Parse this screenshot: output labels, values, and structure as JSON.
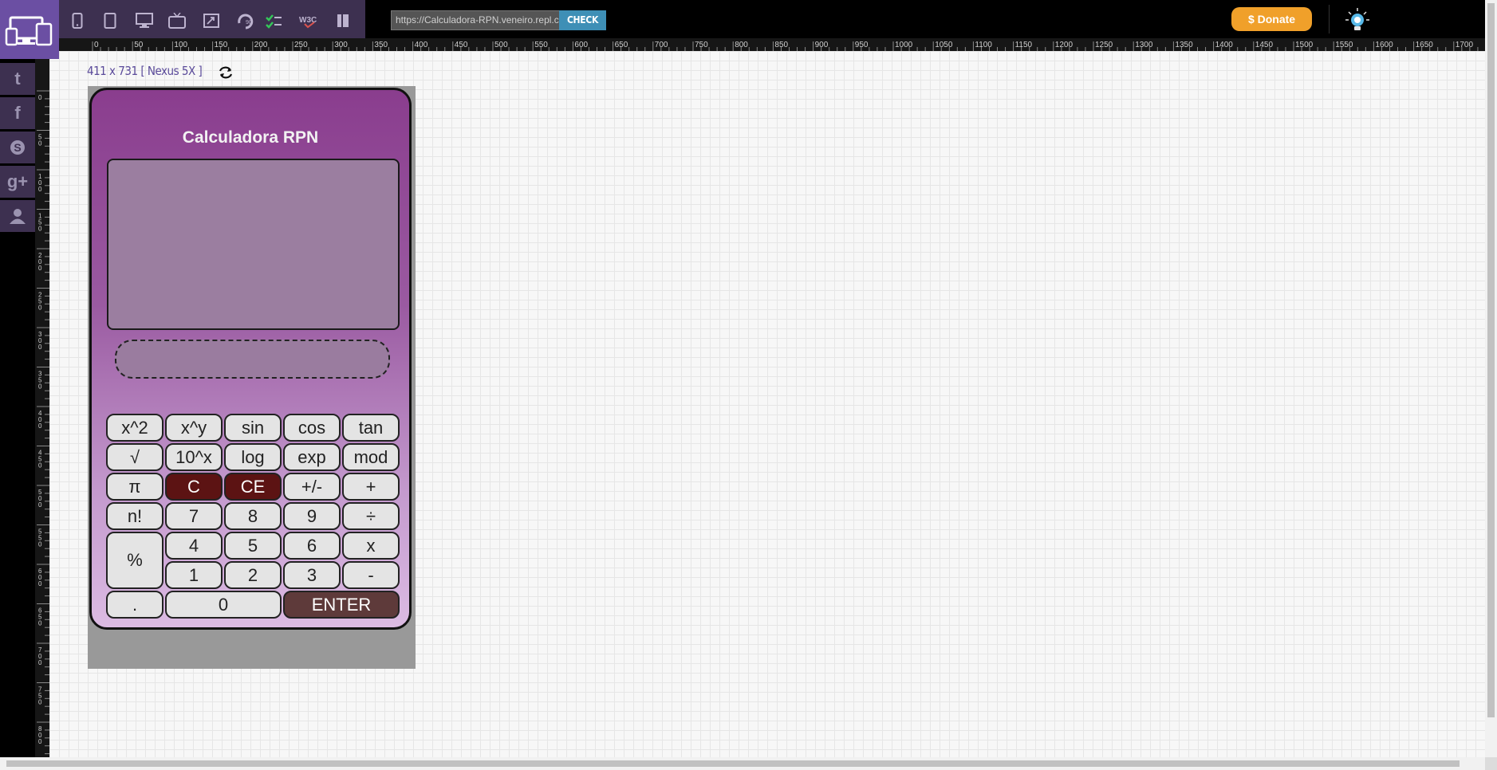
{
  "toolbar": {
    "tools": [
      {
        "name": "mobile-device-icon"
      },
      {
        "name": "tablet-device-icon"
      },
      {
        "name": "desktop-device-icon"
      },
      {
        "name": "tv-device-icon"
      },
      {
        "name": "screen-resize-icon"
      },
      {
        "name": "rotate-90-icon"
      },
      {
        "name": "checklist-icon"
      },
      {
        "name": "w3c-validator-icon"
      },
      {
        "name": "book-icon"
      }
    ],
    "url_value": "https://Calculadora-RPN.veneiro.repl.co",
    "check_label": "CHECK",
    "donate_label": "$ Donate",
    "bulb_icon": "lightbulb-icon"
  },
  "sidebar": {
    "items": [
      {
        "name": "twitter-icon",
        "glyph": "t"
      },
      {
        "name": "facebook-icon",
        "glyph": "f"
      },
      {
        "name": "skype-icon",
        "glyph": "S"
      },
      {
        "name": "google-plus-icon",
        "glyph": "g+"
      },
      {
        "name": "user-icon",
        "glyph": ""
      }
    ]
  },
  "rulers": {
    "top_labels": [
      "0",
      "50",
      "100",
      "150",
      "200",
      "250",
      "300",
      "350",
      "400",
      "450",
      "500",
      "550",
      "600",
      "650",
      "700",
      "750",
      "800",
      "850",
      "900",
      "950",
      "1000",
      "1050",
      "1100",
      "1150",
      "1200",
      "1250",
      "1300",
      "1350",
      "1400",
      "1450",
      "1500",
      "1550",
      "1600",
      "1650",
      "1700"
    ],
    "left_labels": [
      "0",
      "50",
      "100",
      "150",
      "200",
      "250",
      "300",
      "350",
      "400",
      "450",
      "500",
      "550",
      "600",
      "650",
      "700",
      "750",
      "800"
    ]
  },
  "device": {
    "label": "411 x 731 [ Nexus 5X ]"
  },
  "calculator": {
    "title": "Calculadora RPN",
    "entry_value": "",
    "keys": [
      {
        "label": "x^2",
        "name": "key-square"
      },
      {
        "label": "x^y",
        "name": "key-power"
      },
      {
        "label": "sin",
        "name": "key-sin"
      },
      {
        "label": "cos",
        "name": "key-cos"
      },
      {
        "label": "tan",
        "name": "key-tan"
      },
      {
        "label": "√",
        "name": "key-sqrt"
      },
      {
        "label": "10^x",
        "name": "key-ten-power"
      },
      {
        "label": "log",
        "name": "key-log"
      },
      {
        "label": "exp",
        "name": "key-exp"
      },
      {
        "label": "mod",
        "name": "key-mod"
      },
      {
        "label": "π",
        "name": "key-pi"
      },
      {
        "label": "C",
        "name": "key-clear",
        "style": "dark"
      },
      {
        "label": "CE",
        "name": "key-clear-entry",
        "style": "dark"
      },
      {
        "label": "+/-",
        "name": "key-negate"
      },
      {
        "label": "+",
        "name": "key-add"
      },
      {
        "label": "n!",
        "name": "key-factorial"
      },
      {
        "label": "7",
        "name": "key-7"
      },
      {
        "label": "8",
        "name": "key-8"
      },
      {
        "label": "9",
        "name": "key-9"
      },
      {
        "label": "÷",
        "name": "key-divide"
      },
      {
        "label": "%",
        "name": "key-percent"
      },
      {
        "label": "4",
        "name": "key-4"
      },
      {
        "label": "5",
        "name": "key-5"
      },
      {
        "label": "6",
        "name": "key-6"
      },
      {
        "label": "x",
        "name": "key-multiply"
      },
      {
        "label": "1",
        "name": "key-1"
      },
      {
        "label": "2",
        "name": "key-2"
      },
      {
        "label": "3",
        "name": "key-3"
      },
      {
        "label": "-",
        "name": "key-subtract"
      },
      {
        "label": ".",
        "name": "key-decimal"
      },
      {
        "label": "0",
        "name": "key-0"
      },
      {
        "label": "ENTER",
        "name": "key-enter",
        "style": "enter"
      }
    ]
  }
}
